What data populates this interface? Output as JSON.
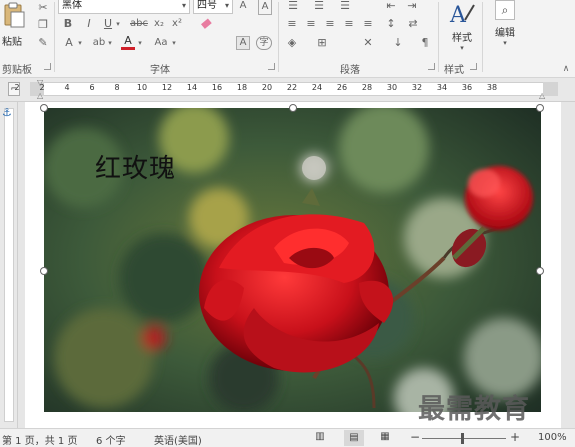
{
  "ribbon": {
    "paste_label": "粘贴",
    "font_name": "黑体",
    "font_size": "四号",
    "clipboard_label": "剪贴板",
    "font_label": "字体",
    "paragraph_label": "段落",
    "styles_label": "样式",
    "styles_button": "样式",
    "edit_button": "编辑",
    "font_color": "#d0202a"
  },
  "ruler": {
    "ticks": [
      "2",
      "2",
      "4",
      "6",
      "8",
      "10",
      "12",
      "14",
      "16",
      "18",
      "20",
      "22",
      "24",
      "26",
      "28",
      "30",
      "32",
      "34",
      "36",
      "38"
    ]
  },
  "document": {
    "image_caption": "红玫瑰"
  },
  "watermark": {
    "text": "最需教育"
  },
  "statusbar": {
    "page": "第 1 页，共 1 页",
    "words": "6 个字",
    "language": "英语(美国)",
    "zoom": "100%"
  }
}
